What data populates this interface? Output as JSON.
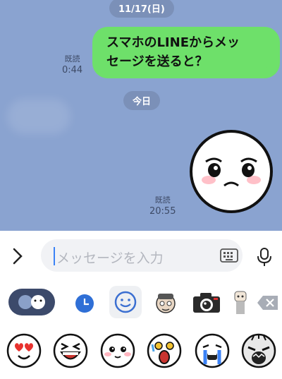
{
  "chat": {
    "date_label": "11/17(日)",
    "today_label": "今日",
    "messages": [
      {
        "text_line1": "スマホのLINEからメッ",
        "text_line2": "セージを送ると？",
        "read": "既読",
        "time": "0:44"
      }
    ],
    "sticker_message": {
      "read": "既読",
      "time": "20:55",
      "sticker": "worried-face-sticker"
    }
  },
  "input": {
    "placeholder": "メッセージを入力",
    "expand_icon": "chevron-right-icon",
    "keyboard_icon": "keyboard-icon",
    "mic_icon": "microphone-icon"
  },
  "sticker_tabs": [
    "emoji-toggle",
    "recent-clock-icon",
    "emoji-smiley-icon",
    "sticker-pack-kid",
    "sticker-pack-camera",
    "sticker-pack-person",
    "backspace-icon"
  ],
  "stickers": [
    "heart-eyes-face",
    "laughing-face",
    "blushing-face",
    "shocked-face",
    "crying-face",
    "screaming-face"
  ],
  "colors": {
    "chat_bg": "#8aa3d0",
    "bubble": "#6ee06a",
    "accent": "#3b82f6"
  }
}
